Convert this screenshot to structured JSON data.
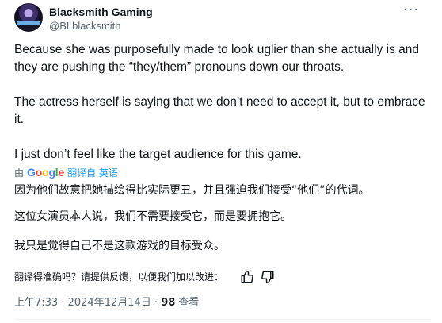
{
  "author": {
    "display_name": "Blacksmith Gaming",
    "handle": "@BLblacksmith",
    "avatar_icon": "profile-avatar"
  },
  "more_menu": {
    "label": "···",
    "icon": "more-horizontal-icon"
  },
  "tweet": {
    "paragraphs": [
      "Because she was purposefully made to look uglier than she actually is and they are pushing the “they/them” pronouns down our throats.",
      "The actress herself is saying that we don’t need to accept it, but to embrace it.",
      "I just don’t feel like the target audience for this game."
    ]
  },
  "translation": {
    "prefix": "由",
    "provider": "Google",
    "provider_colors": [
      "#4285F4",
      "#EA4335",
      "#FBBC05",
      "#4285F4",
      "#34A853",
      "#EA4335"
    ],
    "link_label": "翻译自 英语",
    "paragraphs": [
      "因为他们故意把她描绘得比实际更丑，并且强迫我们接受“他们”的代词。",
      "这位女演员本人说，我们不需要接受它，而是要拥抱它。",
      "我只是觉得自己不是这款游戏的目标受众。"
    ],
    "feedback_prompt": "翻译得准确吗？请提供反馈，以便我们加以改进：",
    "thumbs_up_icon": "thumbs-up-icon",
    "thumbs_down_icon": "thumbs-down-icon"
  },
  "meta": {
    "time": "上午7:33",
    "separator": " · ",
    "date": "2024年12月14日",
    "views_count": "98",
    "views_label": "查看"
  },
  "colors": {
    "text": "#0f1419",
    "secondary": "#536471",
    "link": "#1d9bf0"
  }
}
